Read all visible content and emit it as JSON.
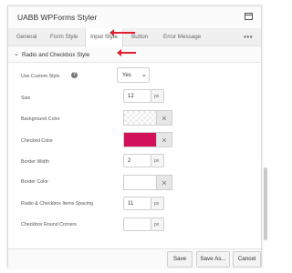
{
  "title": "UABB WPForms Styler",
  "tabs": [
    {
      "label": "General"
    },
    {
      "label": "Form Style"
    },
    {
      "label": "Input Style"
    },
    {
      "label": "Button"
    },
    {
      "label": "Error Message"
    }
  ],
  "more_label": "•••",
  "section": {
    "title": "Radio and Checkbox Style"
  },
  "fields": {
    "use_custom_style": {
      "label": "Use Custom Style",
      "value": "Yes"
    },
    "size": {
      "label": "Size",
      "value": "12",
      "unit": "px"
    },
    "background_color": {
      "label": "Background Color"
    },
    "checked_color": {
      "label": "Checked Color",
      "color": "#d1125a"
    },
    "border_width": {
      "label": "Border Width",
      "value": "2",
      "unit": "px"
    },
    "border_color": {
      "label": "Border Color"
    },
    "items_spacing": {
      "label": "Radio & Checkbox Items Spacing",
      "value": "11",
      "unit": "px"
    },
    "round_corners": {
      "label": "Checkbox Round Corners",
      "value": "",
      "unit": "px"
    }
  },
  "buttons": {
    "save": "Save",
    "save_as": "Save As...",
    "cancel": "Cancel"
  },
  "colors": {
    "accent": "#e1202f",
    "checked_swatch": "#d1125a"
  }
}
